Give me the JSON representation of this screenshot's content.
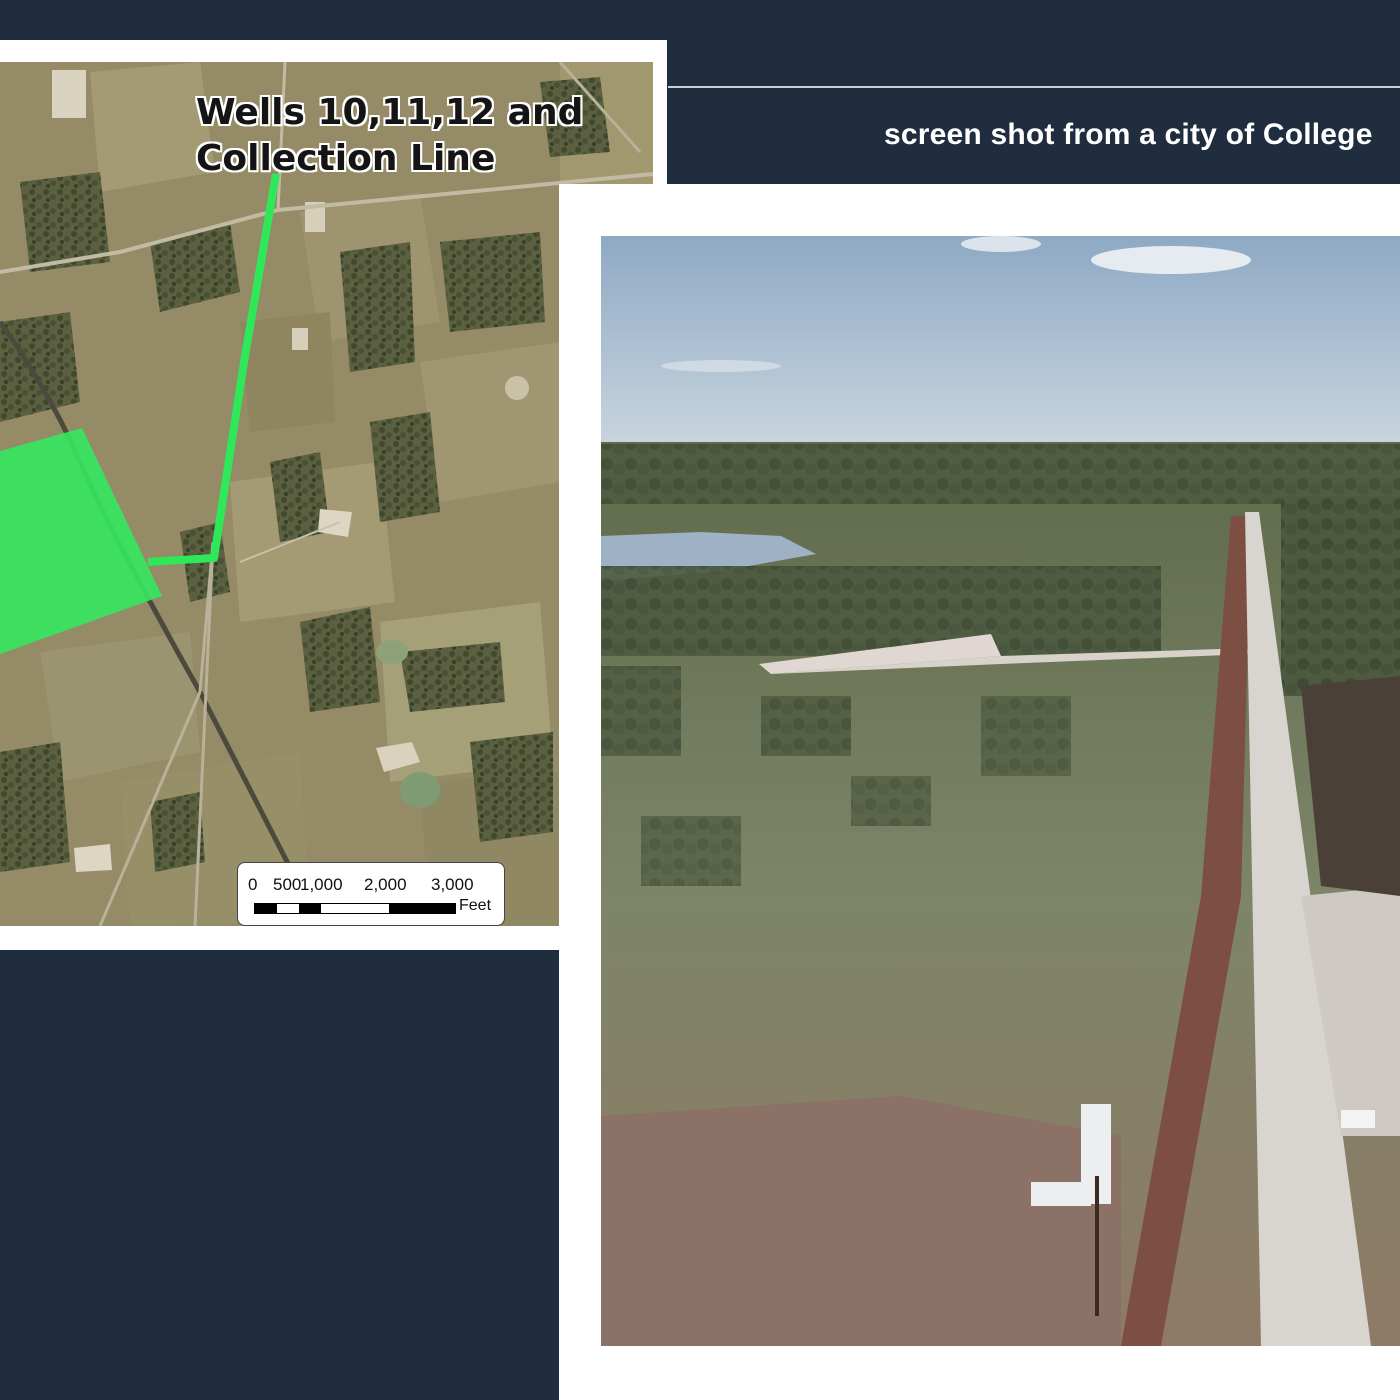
{
  "caption": "screen shot from a city of College",
  "map": {
    "title_line1": "Wells 10,11,12 and",
    "title_line2": "Collection Line",
    "scale_labels": [
      "0",
      "500",
      "1,000",
      "2,000",
      "3,000"
    ],
    "scale_unit": "Feet"
  },
  "colors": {
    "background": "#1f2d3f",
    "collection_line": "#2ee85a",
    "well_area": "#34e860"
  }
}
